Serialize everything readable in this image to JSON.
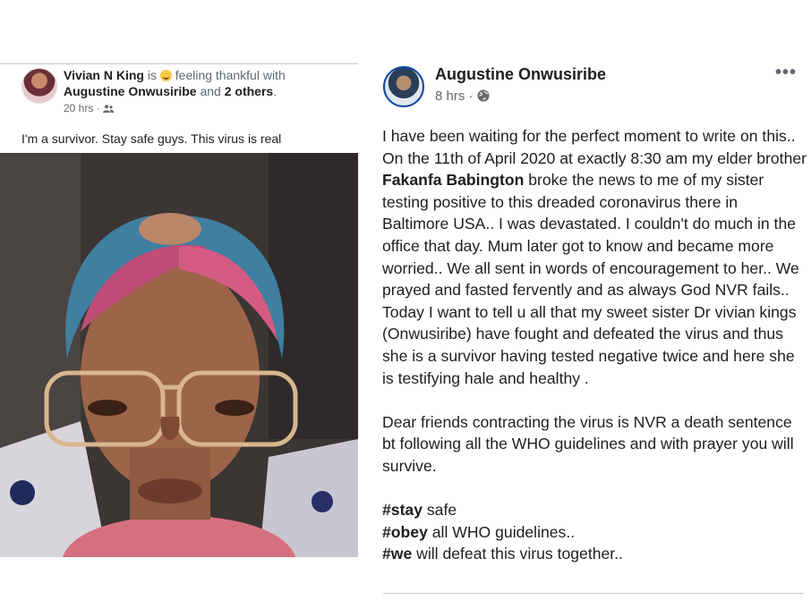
{
  "left_post": {
    "author": "Vivian N King",
    "is_text": " is ",
    "feeling_text": " feeling thankful with",
    "tagged_person": "Augustine Onwusiribe",
    "and_text": " and ",
    "others_text": "2 others",
    "period": ".",
    "timestamp": "20 hrs",
    "dot": " · ",
    "caption": "I'm a survivor. Stay safe guys. This virus is real",
    "icons": {
      "emoji": "smile-emoji-icon",
      "audience": "friends-icon"
    }
  },
  "right_post": {
    "author": "Augustine Onwusiribe",
    "timestamp": "8 hrs",
    "dot": " · ",
    "more": "•••",
    "icons": {
      "audience": "globe-icon",
      "menu": "more-options-icon"
    },
    "para1_a": "I have been waiting for the perfect moment to write on this.. On the 11th of April 2020 at exactly 8:30 am my elder brother ",
    "para1_bold": "Fakanfa Babington",
    "para1_b": " broke the news to me of my sister testing positive to this dreaded coronavirus there in Baltimore USA.. I was devastated. I couldn't do much in the office that day. Mum later got to know and became more worried.. We all sent in words of encouragement to her.. We prayed and fasted fervently and as always God NVR fails.. Today I want to tell u all that my sweet sister Dr vivian kings (Onwusiribe) have fought and defeated the virus and thus she is a survivor having tested negative twice and here she is testifying hale and healthy .",
    "para2": "Dear friends contracting the virus is NVR a death sentence bt following all the WHO guidelines and with prayer you will survive.",
    "hashtags": [
      {
        "tag": "#stay",
        "rest": " safe"
      },
      {
        "tag": "#obey",
        "rest": " all WHO guidelines.."
      },
      {
        "tag": "#we",
        "rest": " will defeat this virus together.."
      }
    ]
  },
  "colors": {
    "text": "#1c1e21",
    "muted": "#65676b",
    "avatar_ring": "#0d47a1"
  }
}
